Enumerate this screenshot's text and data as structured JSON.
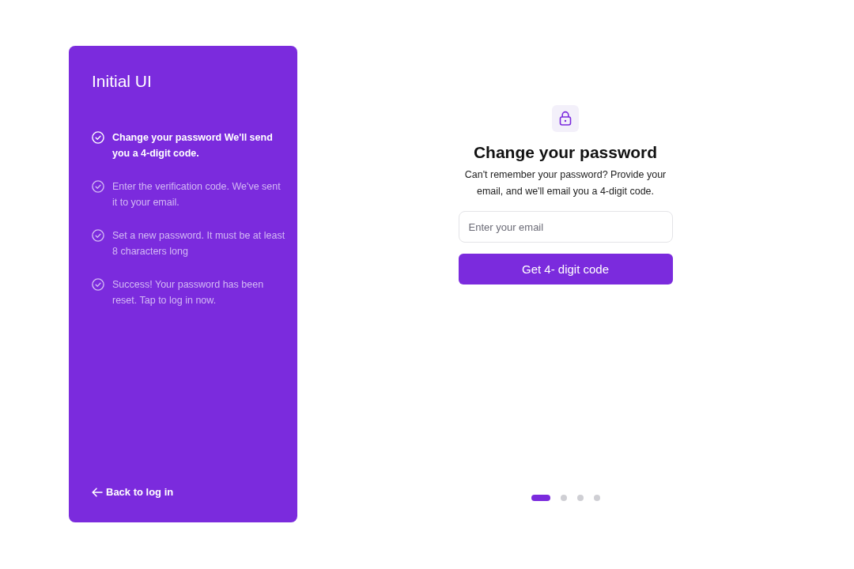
{
  "sidebar": {
    "title": "Initial UI",
    "steps": [
      {
        "text": "Change your password We'll send you a 4-digit code.",
        "selected": true
      },
      {
        "text": "Enter the verification code. We've sent it to your email.",
        "selected": false
      },
      {
        "text": "Set a new password. It must be at least 8 characters long",
        "selected": false
      },
      {
        "text": "Success! Your password has been reset. Tap to log in now.",
        "selected": false
      }
    ],
    "back_link": "Back to log in"
  },
  "main": {
    "heading": "Change your password",
    "description": "Can't remember your password? Provide your email, and we'll email you a 4-digit code.",
    "email_field": {
      "placeholder": "Enter your email"
    },
    "submit_button": "Get 4- digit code",
    "pagination": [
      {
        "selected": true
      },
      {
        "selected": false
      },
      {
        "selected": false
      },
      {
        "selected": false
      }
    ]
  }
}
